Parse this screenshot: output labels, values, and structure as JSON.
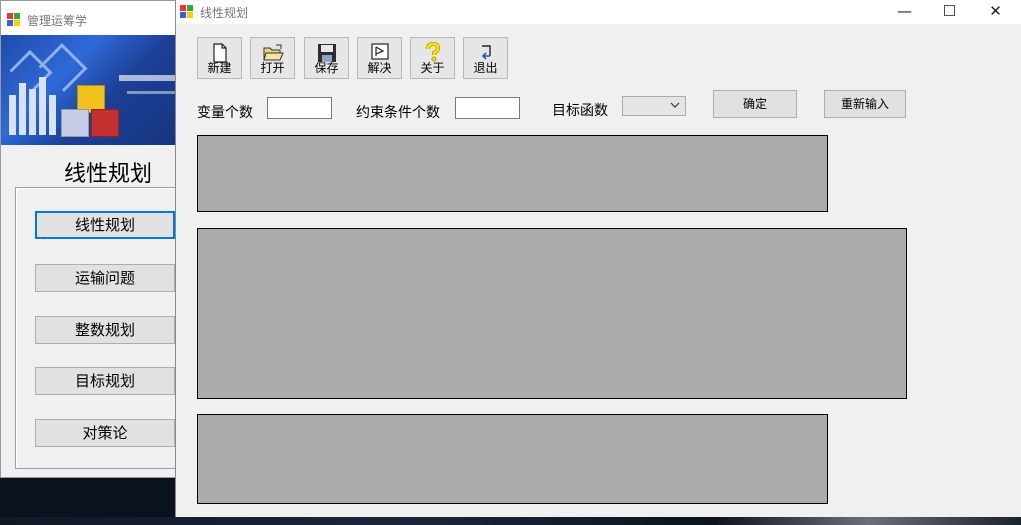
{
  "background_window": {
    "title": "管理运筹学",
    "heading": "线性规划",
    "menu": [
      {
        "label": "线性规划"
      },
      {
        "label": "运输问题"
      },
      {
        "label": "整数规划"
      },
      {
        "label": "目标规划"
      },
      {
        "label": "对策论"
      }
    ]
  },
  "main_window": {
    "title": "线性规划",
    "controls": {
      "minimize": "—",
      "maximize": "☐",
      "close": "✕"
    },
    "toolbar": {
      "new_label": "新建",
      "open_label": "打开",
      "save_label": "保存",
      "solve_label": "解决",
      "about_label": "关于",
      "exit_label": "退出"
    },
    "form": {
      "var_count_label": "变量个数",
      "var_count_value": "",
      "constraint_count_label": "约束条件个数",
      "constraint_count_value": "",
      "objective_label": "目标函数",
      "objective_selected": "",
      "confirm_label": "确定",
      "reset_label": "重新输入"
    }
  },
  "colors": {
    "panel_fill": "#ababab",
    "window_bg": "#f0f0f0",
    "focus_border": "#0078d7"
  }
}
